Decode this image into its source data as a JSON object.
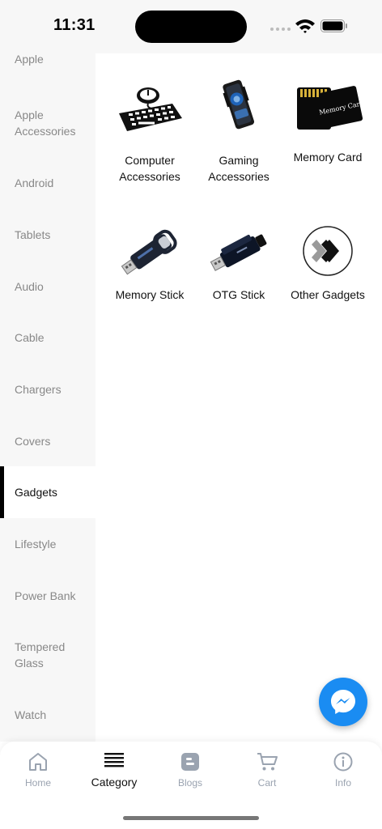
{
  "status_bar": {
    "time": "11:31"
  },
  "sidebar": {
    "items": [
      {
        "label": "Apple"
      },
      {
        "label": "Apple Accessories"
      },
      {
        "label": "Android"
      },
      {
        "label": "Tablets"
      },
      {
        "label": "Audio"
      },
      {
        "label": "Cable"
      },
      {
        "label": "Chargers"
      },
      {
        "label": "Covers"
      },
      {
        "label": "Gadgets",
        "active": true
      },
      {
        "label": "Lifestyle"
      },
      {
        "label": "Power Bank"
      },
      {
        "label": "Tempered Glass"
      },
      {
        "label": "Watch"
      }
    ]
  },
  "categories": [
    {
      "label": "Computer Accessories",
      "icon": "keyboard-mouse-icon"
    },
    {
      "label": "Gaming Accessories",
      "icon": "phone-cooler-icon"
    },
    {
      "label": "Memory Card",
      "icon": "memory-card-icon"
    },
    {
      "label": "Memory Stick",
      "icon": "usb-stick-icon"
    },
    {
      "label": "OTG Stick",
      "icon": "otg-stick-icon"
    },
    {
      "label": "Other Gadgets",
      "icon": "double-chevron-icon"
    }
  ],
  "memory_card_print": "Memory Card",
  "fab": {
    "icon": "messenger-icon",
    "color": "#1a8cf2"
  },
  "bottom_nav": {
    "items": [
      {
        "label": "Home",
        "icon": "home-icon"
      },
      {
        "label": "Category",
        "icon": "menu-icon",
        "active": true
      },
      {
        "label": "Blogs",
        "icon": "blog-icon"
      },
      {
        "label": "Cart",
        "icon": "cart-icon"
      },
      {
        "label": "Info",
        "icon": "info-icon"
      }
    ]
  }
}
